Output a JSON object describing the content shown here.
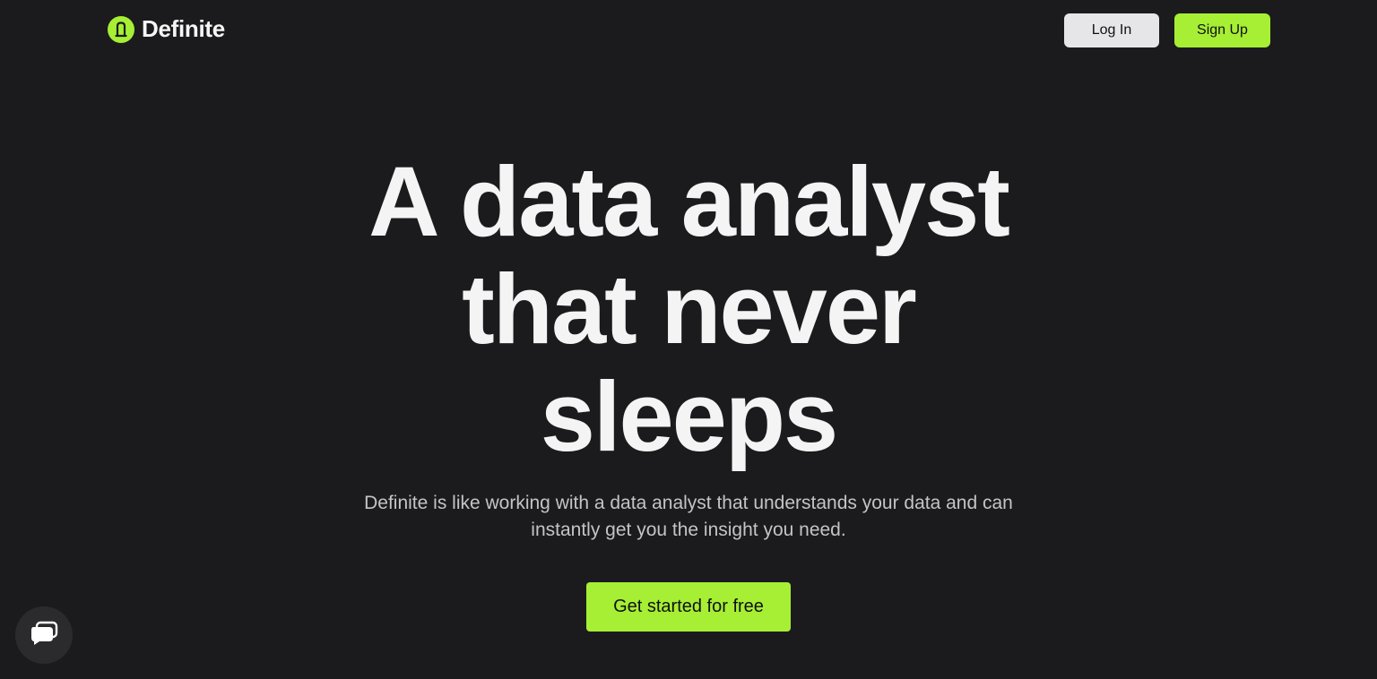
{
  "header": {
    "brand_name": "Definite",
    "login_label": "Log In",
    "signup_label": "Sign Up"
  },
  "hero": {
    "title_lines": [
      "A data analyst",
      "that never",
      "sleeps"
    ],
    "subtitle": "Definite is like working with a data analyst that understands your data and can instantly get you the insight you need.",
    "cta_label": "Get started for free"
  },
  "icons": {
    "logo": "definite-logo-icon",
    "chat": "chat-bubble-icon"
  },
  "colors": {
    "background": "#1b1b1d",
    "accent": "#a6ef35",
    "login_button": "#e6e6e8",
    "text_primary": "#f4f4f4",
    "text_secondary": "#c4c4c6"
  }
}
